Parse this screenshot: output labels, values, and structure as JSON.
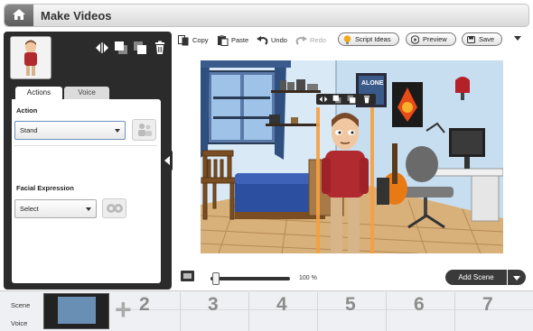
{
  "app": {
    "title": "Make Videos"
  },
  "toolbar": {
    "copy": "Copy",
    "paste": "Paste",
    "undo": "Undo",
    "redo": "Redo",
    "script_ideas": "Script Ideas",
    "preview": "Preview",
    "save": "Save"
  },
  "left_panel": {
    "tabs": [
      "Actions",
      "Voice"
    ],
    "action_label": "Action",
    "action_value": "Stand",
    "facial_label": "Facial Expression",
    "facial_value": "Select"
  },
  "stage": {
    "poster_text": "ALONE"
  },
  "bottom_bar": {
    "zoom": "100 %",
    "add_scene": "Add Scene"
  },
  "timeline": {
    "row_labels": [
      "Scene",
      "Voice"
    ],
    "scene_numbers": [
      "2",
      "3",
      "4",
      "5",
      "6",
      "7"
    ]
  },
  "colors": {
    "panel_dark": "#2b2b2b",
    "wall": "#cfe3f3",
    "floor": "#d8b07a",
    "selection_orange": "#f5a040"
  }
}
